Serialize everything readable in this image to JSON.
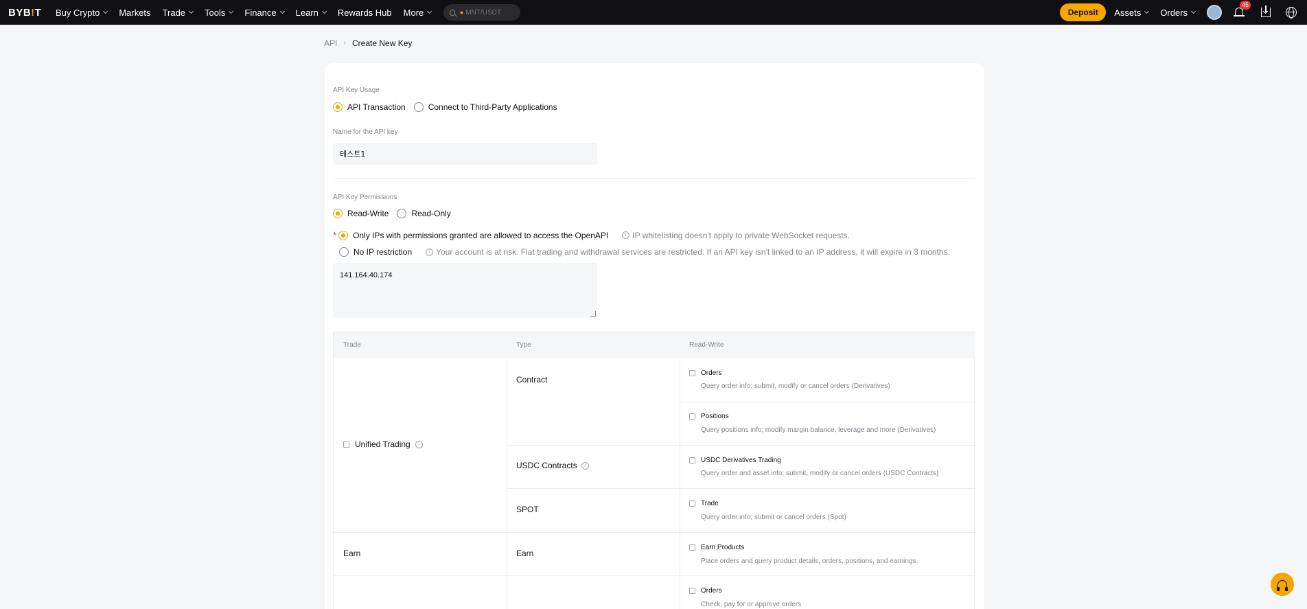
{
  "nav": {
    "logo_a": "BYB",
    "logo_b": "!",
    "logo_c": "T",
    "items": [
      "Buy Crypto",
      "Markets",
      "Trade",
      "Tools",
      "Finance",
      "Learn",
      "Rewards Hub",
      "More"
    ],
    "search_placeholder": "MNT/USDT",
    "deposit": "Deposit",
    "assets": "Assets",
    "orders": "Orders",
    "notif_count": "45"
  },
  "breadcrumb": {
    "parent": "API",
    "current": "Create New Key"
  },
  "form": {
    "usage_label": "API Key Usage",
    "usage_opt1": "API Transaction",
    "usage_opt2": "Connect to Third-Party Applications",
    "name_label": "Name for the API key",
    "name_value": "테스트1",
    "perm_label": "API Key Permissions",
    "perm_opt1": "Read-Write",
    "perm_opt2": "Read-Only",
    "ip_opt1": "Only IPs with permissions granted are allowed to access the OpenAPI",
    "ip_opt1_hint": "IP whitelisting doesn't apply to private WebSocket requests.",
    "ip_opt2": "No IP restriction",
    "ip_opt2_hint": "Your account is at risk. Fiat trading and withdrawal services are restricted. If an API key isn't linked to an IP address, it will expire in 3 months.",
    "ip_value": "141.164.40.174"
  },
  "table": {
    "headers": [
      "Trade",
      "Type",
      "Read-Write"
    ],
    "group1": "Unified Trading",
    "types": [
      "Contract",
      "USDC Contracts",
      "SPOT",
      "Earn"
    ],
    "earn_group": "Earn",
    "perms": [
      {
        "title": "Orders",
        "desc": "Query order info; submit, modify or cancel orders (Derivatives)"
      },
      {
        "title": "Positions",
        "desc": "Query positions info; modify margin balance, leverage and more (Derivatives)"
      },
      {
        "title": "USDC Derivatives Trading",
        "desc": "Query order and asset info; submit, modify or cancel orders (USDC Contracts)"
      },
      {
        "title": "Trade",
        "desc": "Query order info; submit or cancel orders (Spot)"
      },
      {
        "title": "Earn Products",
        "desc": "Place orders and query product details, orders, positions, and earnings."
      },
      {
        "title": "Orders",
        "desc": "Check, pay for or approve orders"
      }
    ]
  }
}
